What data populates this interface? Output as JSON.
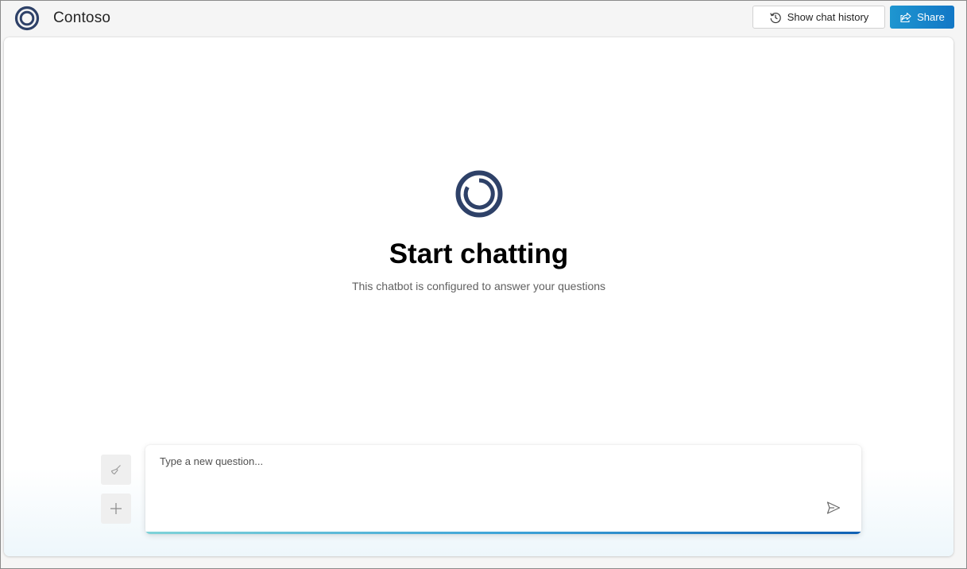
{
  "app": {
    "title": "Contoso",
    "logo_icon": "contoso-ring-logo",
    "brand_color": "#2e4168"
  },
  "header": {
    "history_button": {
      "label": "Show chat history",
      "icon": "history-icon"
    },
    "share_button": {
      "label": "Share",
      "icon": "share-icon",
      "color": "#1a88cd"
    }
  },
  "chat": {
    "title": "Start chatting",
    "subtitle": "This chatbot is configured to answer your questions",
    "input": {
      "placeholder": "Type a new question...",
      "value": ""
    },
    "actions": {
      "clear_icon": "broom-icon",
      "new_chat_icon": "plus-icon",
      "send_icon": "send-icon"
    }
  }
}
